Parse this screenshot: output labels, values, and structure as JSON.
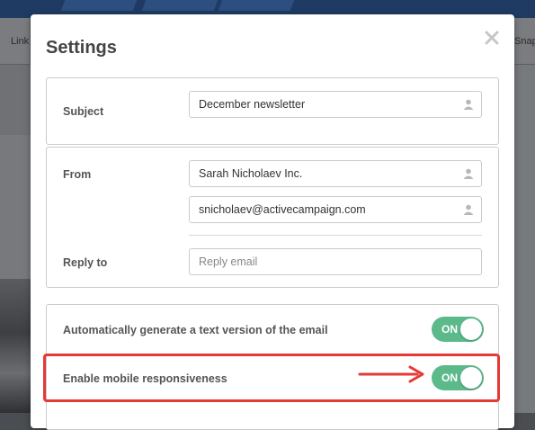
{
  "background": {
    "toolbar_left_label": "Link",
    "toolbar_right_label": "Snap"
  },
  "modal": {
    "title": "Settings",
    "close_icon": "close-icon"
  },
  "subject": {
    "label": "Subject",
    "value": "December newsletter",
    "icon": "user-icon"
  },
  "from": {
    "label": "From",
    "name_value": "Sarah Nicholaev Inc.",
    "email_value": "snicholaev@activecampaign.com",
    "icon": "user-icon"
  },
  "reply_to": {
    "label": "Reply to",
    "placeholder": "Reply email"
  },
  "toggles": [
    {
      "label": "Automatically generate a text version of the email",
      "state": "ON"
    },
    {
      "label": "Enable mobile responsiveness",
      "state": "ON"
    }
  ],
  "colors": {
    "toggle_on": "#5bb98a",
    "highlight": "#e53935"
  }
}
